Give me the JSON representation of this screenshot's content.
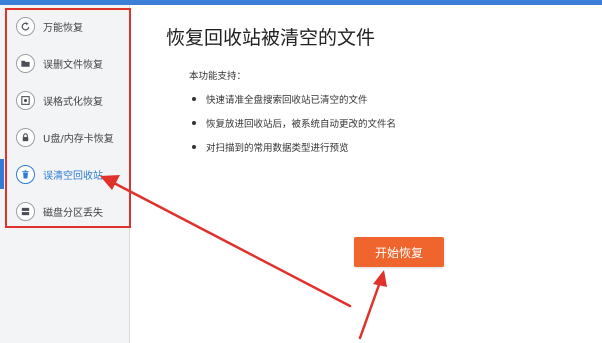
{
  "sidebar": {
    "items": [
      {
        "label": "万能恢复",
        "icon": "refresh-icon"
      },
      {
        "label": "误删文件恢复",
        "icon": "folder-icon"
      },
      {
        "label": "误格式化恢复",
        "icon": "disk-icon"
      },
      {
        "label": "U盘/内存卡恢复",
        "icon": "lock-icon"
      },
      {
        "label": "误清空回收站",
        "icon": "trash-icon",
        "active": true
      },
      {
        "label": "磁盘分区丢失",
        "icon": "partition-icon"
      }
    ]
  },
  "main": {
    "title": "恢复回收站被清空的文件",
    "support_label": "本功能支持：",
    "features": [
      "快速请准全盘搜索回收站已清空的文件",
      "恢复放进回收站后，被系统自动更改的文件名",
      "对扫描到的常用数据类型进行预览"
    ],
    "start_button": "开始恢复"
  },
  "colors": {
    "accent": "#2f7bd6",
    "annotation_red": "#e0312b",
    "button_orange": "#f0652d"
  }
}
